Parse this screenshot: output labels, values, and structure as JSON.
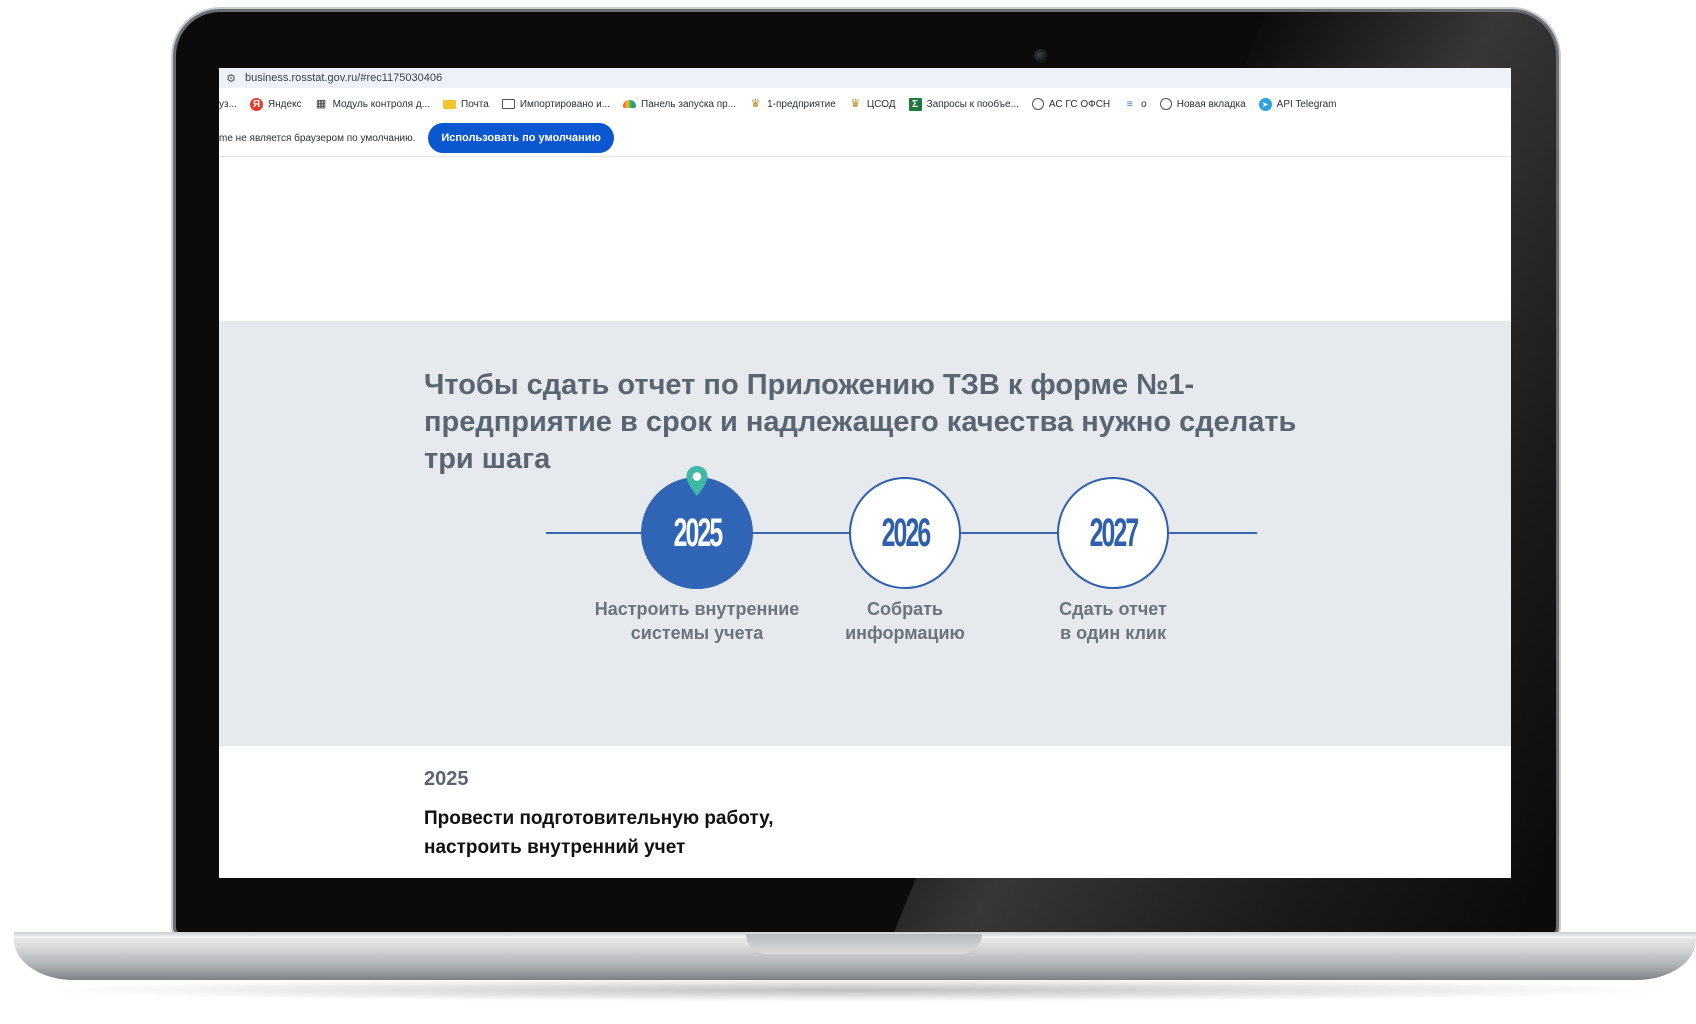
{
  "browser": {
    "url": "business.rosstat.gov.ru/#rec1175030406",
    "bookmarks": [
      {
        "label": "уз...",
        "icon": "none"
      },
      {
        "label": "Яндекс",
        "icon": "yandex-icon"
      },
      {
        "label": "Модуль контроля д...",
        "icon": "grid-icon"
      },
      {
        "label": "Почта",
        "icon": "mail-icon"
      },
      {
        "label": "Импортировано и...",
        "icon": "folder-icon"
      },
      {
        "label": "Панель запуска пр...",
        "icon": "rainbow-icon"
      },
      {
        "label": "1-предприятие",
        "icon": "emblem-icon"
      },
      {
        "label": "ЦСОД",
        "icon": "emblem-icon"
      },
      {
        "label": "Запросы к пообъе...",
        "icon": "sigma-icon"
      },
      {
        "label": "АС ГС ОФСН",
        "icon": "globe-icon"
      },
      {
        "label": "o",
        "icon": "lines-icon"
      },
      {
        "label": "Новая вкладка",
        "icon": "globe-icon"
      },
      {
        "label": "API Telegram",
        "icon": "telegram-icon"
      }
    ],
    "infobar": {
      "text": "me не является браузером по умолчанию.",
      "button": "Использовать по умолчанию"
    }
  },
  "page": {
    "title": "Чтобы сдать отчет по Приложению ТЗВ к форме №1-предприятие в срок и надлежащего качества нужно сделать три шага",
    "steps": [
      {
        "year": "2025",
        "label": "Настроить внутренние\nсистемы учета",
        "active": true
      },
      {
        "year": "2026",
        "label": "Собрать\nинформацию",
        "active": false
      },
      {
        "year": "2027",
        "label": "Сдать отчет\nв один клик",
        "active": false
      }
    ],
    "section_year": "2025",
    "section_heading": "Провести подготовительную работу, настроить внутренний учет"
  },
  "colors": {
    "accent": "#2f65b4",
    "hero_bg": "#e6e9ee",
    "pin": "#3fb8a6",
    "button": "#0b57d0"
  }
}
